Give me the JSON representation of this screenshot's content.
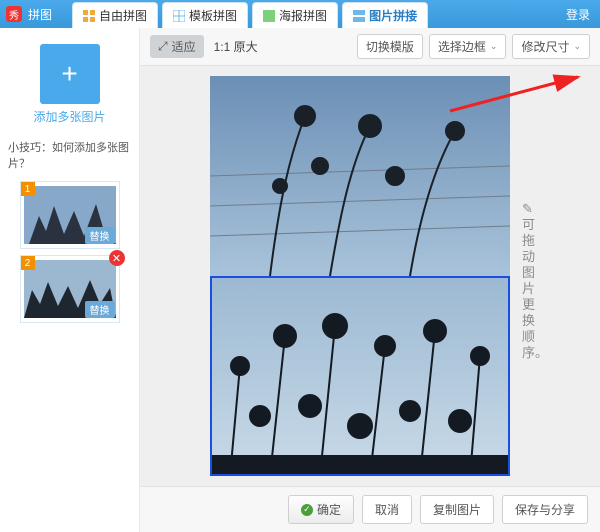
{
  "header": {
    "app_title": "拼图",
    "login": "登录",
    "tabs": [
      {
        "label": "自由拼图",
        "icon_color": "#f2a93b"
      },
      {
        "label": "模板拼图",
        "icon_color": "#6fb9e8"
      },
      {
        "label": "海报拼图",
        "icon_color": "#7fd07a"
      },
      {
        "label": "图片拼接",
        "icon_color": "#6fb9e8"
      }
    ],
    "active_tab_index": 3
  },
  "sidebar": {
    "add_symbol": "+",
    "add_label": "添加多张图片",
    "tip": "小技巧：如何添加多张图片？",
    "thumbs": [
      {
        "num": "1",
        "swap": "替换"
      },
      {
        "num": "2",
        "swap": "替换"
      }
    ],
    "delete_symbol": "✕"
  },
  "toolbar": {
    "fit": "适应",
    "scale": "1:1 原大",
    "switch_template": "切换模版",
    "select_border": "选择边框",
    "resize": "修改尺寸",
    "caret": "⌄"
  },
  "canvas": {
    "annotation": "✎可拖动图片更换顺序。"
  },
  "footer": {
    "confirm": "确定",
    "cancel": "取消",
    "copy": "复制图片",
    "save_share": "保存与分享"
  }
}
